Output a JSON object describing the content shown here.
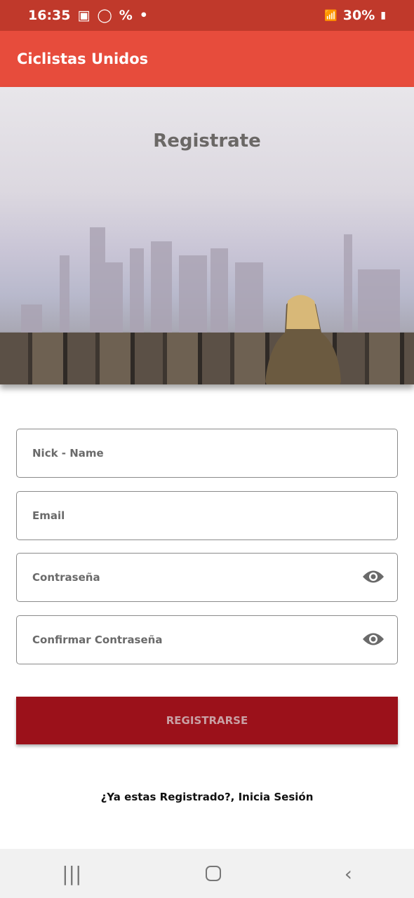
{
  "status_bar": {
    "time": "16:35",
    "battery": "30%"
  },
  "app_bar": {
    "title": "Ciclistas Unidos"
  },
  "hero": {
    "title": "Registrate"
  },
  "form": {
    "nickname_placeholder": "Nick - Name",
    "email_placeholder": "Email",
    "password_placeholder": "Contraseña",
    "confirm_password_placeholder": "Confirmar Contraseña",
    "submit_label": "REGISTRARSE"
  },
  "login_link": "¿Ya estas Registrado?, Inicia Sesión",
  "colors": {
    "status_bar": "#c0392b",
    "app_bar": "#e74c3c",
    "button": "#9b111a"
  },
  "nav_icons": [
    "recent-apps-icon",
    "home-icon",
    "back-icon"
  ]
}
